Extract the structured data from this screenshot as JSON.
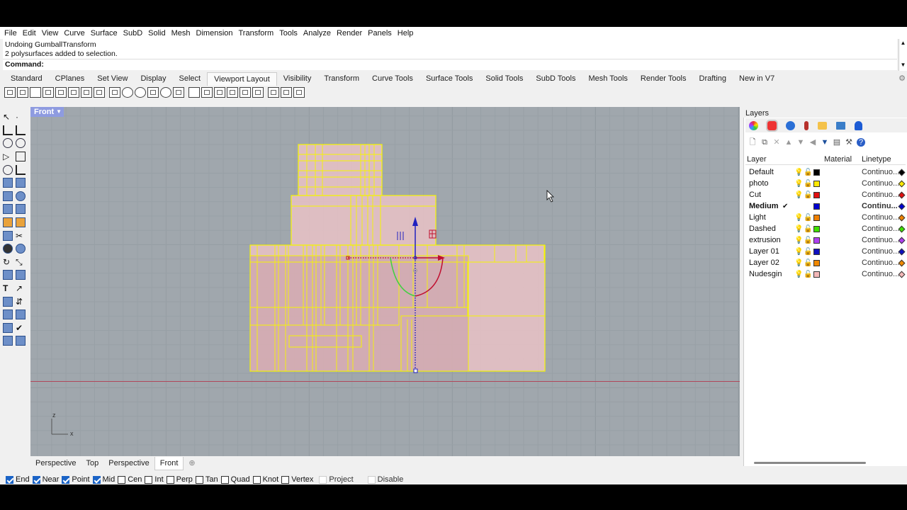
{
  "menu": [
    "File",
    "Edit",
    "View",
    "Curve",
    "Surface",
    "SubD",
    "Solid",
    "Mesh",
    "Dimension",
    "Transform",
    "Tools",
    "Analyze",
    "Render",
    "Panels",
    "Help"
  ],
  "command_history": [
    "Undoing GumballTransform",
    "2 polysurfaces added to selection."
  ],
  "command_prompt": "Command:",
  "toolbar_tabs": [
    "Standard",
    "CPlanes",
    "Set View",
    "Display",
    "Select",
    "Viewport Layout",
    "Visibility",
    "Transform",
    "Curve Tools",
    "Surface Tools",
    "Solid Tools",
    "SubD Tools",
    "Mesh Tools",
    "Render Tools",
    "Drafting",
    "New in V7"
  ],
  "active_toolbar_tab": "Viewport Layout",
  "viewport": {
    "title": "Front",
    "axis_x": "x",
    "axis_z": "z"
  },
  "viewport_tabs": [
    "Perspective",
    "Top",
    "Perspective",
    "Front"
  ],
  "active_viewport_tab": "Front",
  "layers_panel": {
    "title": "Layers",
    "columns": [
      "Layer",
      "Material",
      "Linetype"
    ],
    "layers": [
      {
        "name": "Default",
        "color": "#000000",
        "linetype": "Continuo...",
        "current": false
      },
      {
        "name": "photo",
        "color": "#ffe800",
        "linetype": "Continuo...",
        "current": false
      },
      {
        "name": "Cut",
        "color": "#e01010",
        "linetype": "Continuo...",
        "current": false
      },
      {
        "name": "Medium",
        "color": "#0000d0",
        "linetype": "Continu...",
        "current": true
      },
      {
        "name": "Light",
        "color": "#f08000",
        "linetype": "Continuo...",
        "current": false
      },
      {
        "name": "Dashed",
        "color": "#40e000",
        "linetype": "Continuo...",
        "current": false
      },
      {
        "name": "extrusion",
        "color": "#b040f0",
        "linetype": "Continuo...",
        "current": false
      },
      {
        "name": "Layer 01",
        "color": "#1010c0",
        "linetype": "Continuo...",
        "current": false
      },
      {
        "name": "Layer 02",
        "color": "#f08800",
        "linetype": "Continuo...",
        "current": false
      },
      {
        "name": "Nudesgin",
        "color": "#f4b8b8",
        "linetype": "Continuo...",
        "current": false
      }
    ]
  },
  "osnaps": [
    {
      "label": "End",
      "on": true
    },
    {
      "label": "Near",
      "on": true
    },
    {
      "label": "Point",
      "on": true
    },
    {
      "label": "Mid",
      "on": true
    },
    {
      "label": "Cen",
      "on": false
    },
    {
      "label": "Int",
      "on": false
    },
    {
      "label": "Perp",
      "on": false
    },
    {
      "label": "Tan",
      "on": false
    },
    {
      "label": "Quad",
      "on": false
    },
    {
      "label": "Knot",
      "on": false
    },
    {
      "label": "Vertex",
      "on": false
    },
    {
      "label": "Project",
      "on": false,
      "disabled": true
    },
    {
      "label": "Disable",
      "on": false,
      "disabled": true
    }
  ],
  "icons": [
    "gear-icon",
    "cursor-icon",
    "layer-color-icon",
    "material-icon",
    "new-layer-icon",
    "filter-icon",
    "help-icon",
    "lightbulb-icon",
    "lock-icon"
  ]
}
